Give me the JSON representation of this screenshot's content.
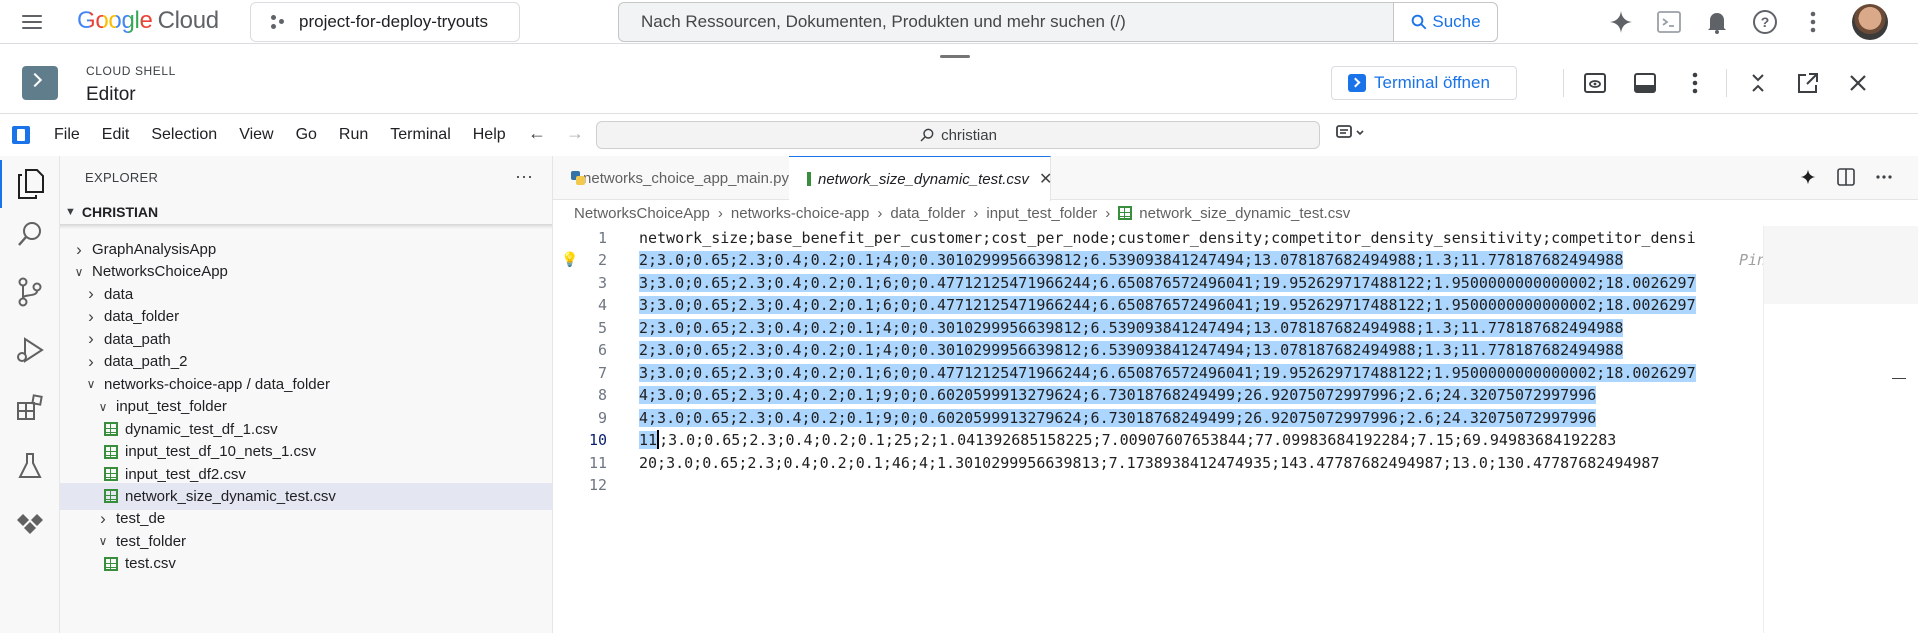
{
  "gcp": {
    "logo_google": "Google",
    "logo_cloud": "Cloud",
    "project_name": "project-for-deploy-tryouts",
    "search_placeholder": "Nach Ressourcen, Dokumenten, Produkten und mehr suchen (/)",
    "search_button": "Suche"
  },
  "shell": {
    "subtitle": "CLOUD SHELL",
    "title": "Editor",
    "terminal_button": "Terminal öffnen"
  },
  "menu": {
    "items": [
      "File",
      "Edit",
      "Selection",
      "View",
      "Go",
      "Run",
      "Terminal",
      "Help"
    ],
    "command_center": "christian"
  },
  "explorer": {
    "title": "EXPLORER",
    "more": "···",
    "root": "CHRISTIAN",
    "tree": [
      {
        "label": "GraphAnalysisApp",
        "type": "folder",
        "expanded": false,
        "depth": 1
      },
      {
        "label": "NetworksChoiceApp",
        "type": "folder",
        "expanded": true,
        "depth": 1
      },
      {
        "label": "data",
        "type": "folder",
        "expanded": false,
        "depth": 2
      },
      {
        "label": "data_folder",
        "type": "folder",
        "expanded": false,
        "depth": 2
      },
      {
        "label": "data_path",
        "type": "folder",
        "expanded": false,
        "depth": 2
      },
      {
        "label": "data_path_2",
        "type": "folder",
        "expanded": false,
        "depth": 2
      },
      {
        "label": "networks-choice-app / data_folder",
        "type": "folder",
        "expanded": true,
        "depth": 2
      },
      {
        "label": "input_test_folder",
        "type": "folder",
        "expanded": true,
        "depth": 3
      },
      {
        "label": "dynamic_test_df_1.csv",
        "type": "csv",
        "depth": 4
      },
      {
        "label": "input_test_df_10_nets_1.csv",
        "type": "csv",
        "depth": 4
      },
      {
        "label": "input_test_df2.csv",
        "type": "csv",
        "depth": 4
      },
      {
        "label": "network_size_dynamic_test.csv",
        "type": "csv",
        "depth": 4,
        "selected": true
      },
      {
        "label": "test_de",
        "type": "folder",
        "expanded": false,
        "depth": 3
      },
      {
        "label": "test_folder",
        "type": "folder",
        "expanded": true,
        "depth": 3
      },
      {
        "label": "test.csv",
        "type": "csv",
        "depth": 4
      }
    ]
  },
  "editor": {
    "tabs": [
      {
        "label": "networks_choice_app_main.py",
        "active": false
      },
      {
        "label": "network_size_dynamic_test.csv",
        "active": true
      }
    ],
    "breadcrumb": [
      "NetworksChoiceApp",
      "networks-choice-app",
      "data_folder",
      "input_test_folder",
      "network_size_dynamic_test.csv"
    ],
    "pin_hint": "Pin",
    "lines": [
      {
        "n": "1",
        "text": "network_size;base_benefit_per_customer;cost_per_node;customer_density;competitor_density_sensitivity;competitor_densi"
      },
      {
        "n": "2",
        "text": "2;3.0;0.65;2.3;0.4;0.2;0.1;4;0;0.3010299956639812;6.539093841247494;13.078187682494988;1.3;11.778187682494988"
      },
      {
        "n": "3",
        "text": "3;3.0;0.65;2.3;0.4;0.2;0.1;6;0;0.47712125471966244;6.650876572496041;19.952629717488122;1.9500000000000002;18.0026297"
      },
      {
        "n": "4",
        "text": "3;3.0;0.65;2.3;0.4;0.2;0.1;6;0;0.47712125471966244;6.650876572496041;19.952629717488122;1.9500000000000002;18.0026297"
      },
      {
        "n": "5",
        "text": "2;3.0;0.65;2.3;0.4;0.2;0.1;4;0;0.3010299956639812;6.539093841247494;13.078187682494988;1.3;11.778187682494988"
      },
      {
        "n": "6",
        "text": "2;3.0;0.65;2.3;0.4;0.2;0.1;4;0;0.3010299956639812;6.539093841247494;13.078187682494988;1.3;11.778187682494988"
      },
      {
        "n": "7",
        "text": "3;3.0;0.65;2.3;0.4;0.2;0.1;6;0;0.47712125471966244;6.650876572496041;19.952629717488122;1.9500000000000002;18.0026297"
      },
      {
        "n": "8",
        "text": "4;3.0;0.65;2.3;0.4;0.2;0.1;9;0;0.6020599913279624;6.73018768249499;26.92075072997996;2.6;24.32075072997996"
      },
      {
        "n": "9",
        "text": "4;3.0;0.65;2.3;0.4;0.2;0.1;9;0;0.6020599913279624;6.73018768249499;26.92075072997996;2.6;24.32075072997996"
      },
      {
        "n": "10",
        "sel": "11",
        "text": ";3.0;0.65;2.3;0.4;0.2;0.1;25;2;1.041392685158225;7.00907607653844;77.09983684192284;7.15;69.94983684192283"
      },
      {
        "n": "11",
        "text": "20;3.0;0.65;2.3;0.4;0.2;0.1;46;4;1.3010299956639813;7.1738938412474935;143.47787682494987;13.0;130.47787682494987"
      },
      {
        "n": "12",
        "text": ""
      }
    ]
  }
}
